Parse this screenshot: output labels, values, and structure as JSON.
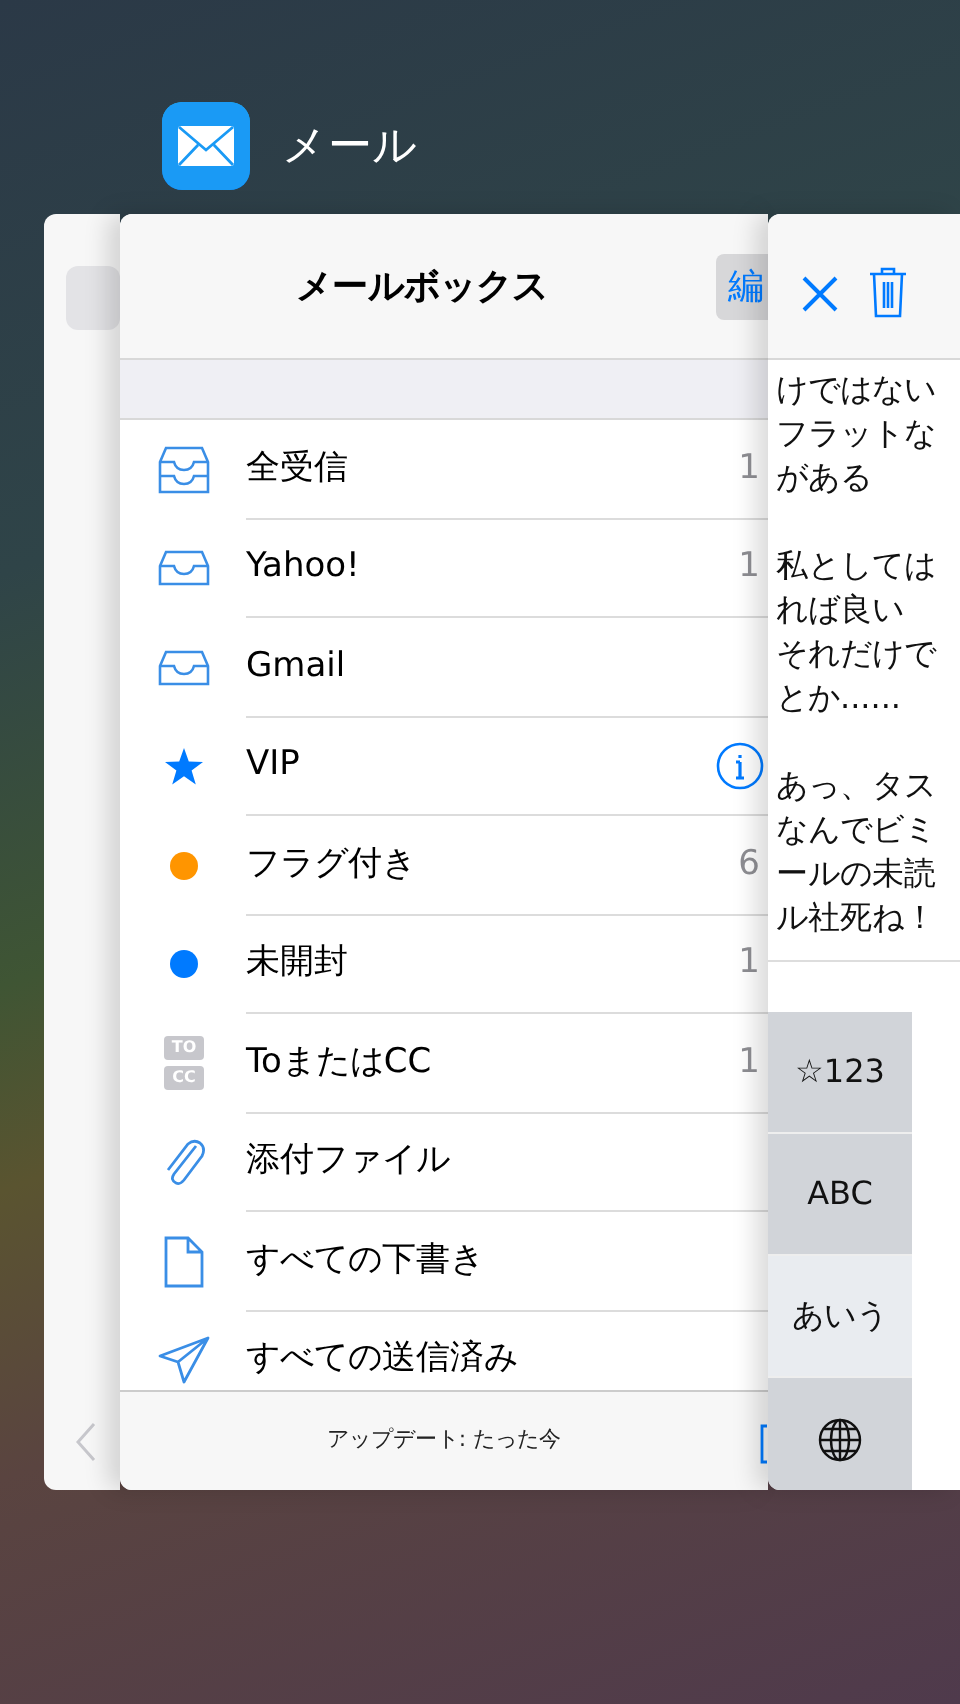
{
  "app": {
    "name": "メール"
  },
  "mailboxes_card": {
    "title": "メールボックス",
    "edit_button": "編",
    "rows": [
      {
        "kind": "all-inbox",
        "label": "全受信",
        "count": "1"
      },
      {
        "kind": "inbox",
        "label": "Yahoo!",
        "count": "1"
      },
      {
        "kind": "inbox",
        "label": "Gmail"
      },
      {
        "kind": "star",
        "label": "VIP",
        "info_button": true
      },
      {
        "kind": "dot",
        "label": "フラグ付き",
        "count": "6",
        "color": "#ff9500"
      },
      {
        "kind": "dot",
        "label": "未開封",
        "count": "1",
        "color": "#007aff"
      },
      {
        "kind": "to-cc",
        "label": "ToまたはCC",
        "count": "1",
        "icon_text": [
          "TO",
          "CC"
        ]
      },
      {
        "kind": "clip",
        "label": "添付ファイル"
      },
      {
        "kind": "doc",
        "label": "すべての下書き"
      },
      {
        "kind": "send",
        "label": "すべての送信済み"
      }
    ],
    "status": "アップデート: たった今"
  },
  "message_card": {
    "body_paragraphs": [
      [
        "けではない",
        "フラットな",
        "がある"
      ],
      [
        "私としては",
        "れば良い",
        "それだけで",
        "とか......"
      ],
      [
        "あっ、タス",
        "なんでビミ",
        "ールの未読",
        "ル社死ね！"
      ]
    ],
    "keyboard_keys": [
      {
        "kind": "text",
        "label": "☆123",
        "selected": false
      },
      {
        "kind": "text",
        "label": "ABC",
        "selected": false
      },
      {
        "kind": "text",
        "label": "あいう",
        "selected": true
      },
      {
        "kind": "globe",
        "selected": false
      }
    ]
  }
}
